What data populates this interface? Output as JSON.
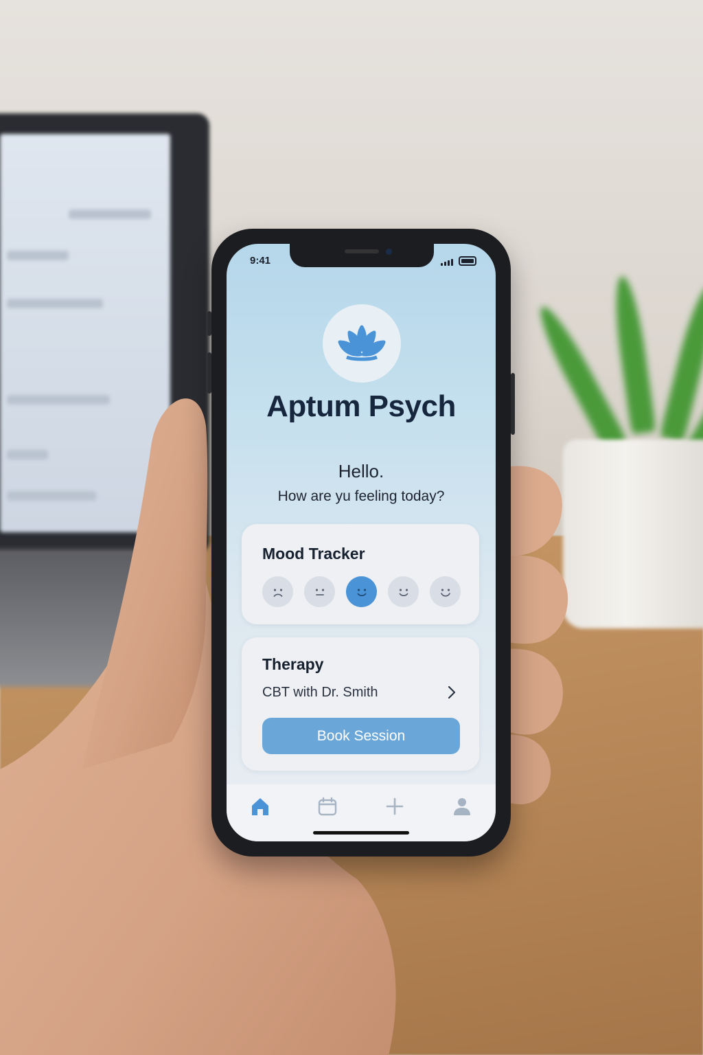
{
  "status_bar": {
    "time": "9:41"
  },
  "app": {
    "name": "Aptum Psych",
    "logo_icon": "lotus-icon"
  },
  "greeting": {
    "hello": "Hello.",
    "question": "How are yu feeling today?"
  },
  "mood_tracker": {
    "title": "Mood Tracker",
    "moods": [
      {
        "icon": "sad-face-icon",
        "selected": false
      },
      {
        "icon": "neutral-face-icon",
        "selected": false
      },
      {
        "icon": "content-face-icon",
        "selected": true
      },
      {
        "icon": "happy-face-icon",
        "selected": false
      },
      {
        "icon": "very-happy-face-icon",
        "selected": false
      }
    ]
  },
  "therapy": {
    "title": "Therapy",
    "session": "CBT with Dr. Smith",
    "book_label": "Book Session"
  },
  "tab_bar": {
    "items": [
      {
        "icon": "home-icon",
        "active": true
      },
      {
        "icon": "calendar-icon",
        "active": false
      },
      {
        "icon": "plus-icon",
        "active": false
      },
      {
        "icon": "profile-icon",
        "active": false
      }
    ]
  },
  "colors": {
    "accent": "#4a93d6",
    "button": "#6aa7d8",
    "title_text": "#16273d",
    "inactive_icon": "#a5b3c3"
  }
}
